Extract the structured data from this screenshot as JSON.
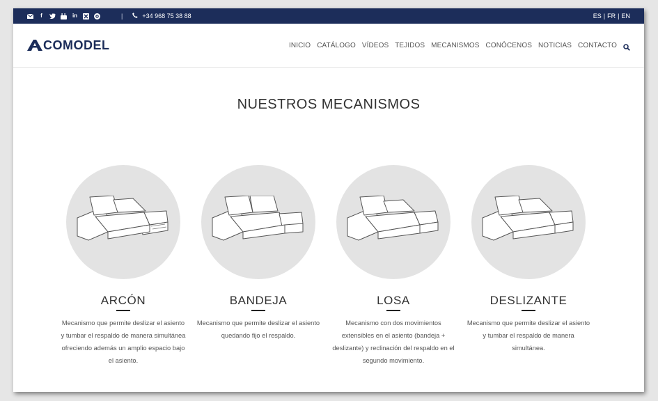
{
  "topbar": {
    "social_icons": [
      "mail-icon",
      "facebook-icon",
      "twitter-icon",
      "youtube-icon",
      "linkedin-icon",
      "xing-icon",
      "pinterest-icon"
    ],
    "separator": "|",
    "phone": "+34 968 75 38 88",
    "languages": [
      "ES",
      "FR",
      "EN"
    ],
    "lang_sep": "|"
  },
  "header": {
    "logo_text": "COMODEL",
    "nav": [
      "INICIO",
      "CATÁLOGO",
      "VÍDEOS",
      "TEJIDOS",
      "MECANISMOS",
      "CONÓCENOS",
      "NOTICIAS",
      "CONTACTO"
    ]
  },
  "main": {
    "title": "NUESTROS MECANISMOS",
    "mechanisms": [
      {
        "title": "ARCÓN",
        "description": "Mecanismo que permite deslizar el asiento y tumbar el respaldo de manera simultánea ofreciendo además un amplio espacio bajo el asiento."
      },
      {
        "title": "BANDEJA",
        "description": "Mecanismo que permite deslizar el asiento quedando fijo el respaldo."
      },
      {
        "title": "LOSA",
        "description": "Mecanismo con dos movimientos extensibles en el asiento (bandeja + deslizante) y reclinación del respaldo en el segundo movimiento."
      },
      {
        "title": "DESLIZANTE",
        "description": "Mecanismo que permite deslizar el asiento y tumbar el respaldo de manera simultánea."
      }
    ]
  },
  "colors": {
    "brand": "#1c2d5a",
    "circle": "#e3e3e3"
  }
}
